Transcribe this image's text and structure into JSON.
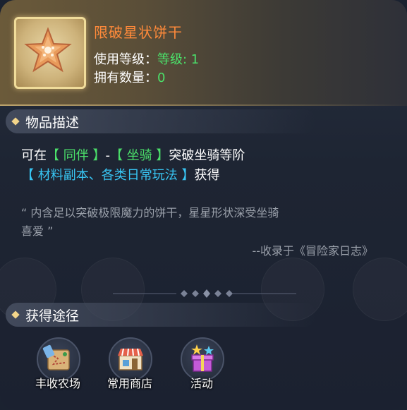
{
  "item": {
    "name": "限破星状饼干",
    "level_label": "使用等级：",
    "level_value": "等级: 1",
    "count_label": "拥有数量：",
    "count_value": "0",
    "icon": "star-cookie-icon"
  },
  "description": {
    "title": "物品描述",
    "line1_prefix": "可在",
    "line1_link1": "【 同伴 】",
    "line1_dash": "-",
    "line1_link2": "【 坐骑 】",
    "line1_suffix": "突破坐骑等阶",
    "line2_link": "【 材料副本、各类日常玩法 】",
    "line2_suffix": "获得",
    "quote_line1": "“ 内含足以突破极限魔力的饼干，星星形状深受坐骑",
    "quote_line2": "喜爱 ”",
    "source": "--收录于《冒险家日志》"
  },
  "acquire": {
    "title": "获得途径",
    "sources": [
      {
        "label": "丰收农场",
        "icon": "farm-map-icon"
      },
      {
        "label": "常用商店",
        "icon": "shop-icon"
      },
      {
        "label": "活动",
        "icon": "gift-stars-icon"
      }
    ]
  },
  "colors": {
    "name": "#ff8a3a",
    "green": "#4be06a",
    "cyan": "#38c6f4",
    "quote": "#9aa0aa"
  }
}
